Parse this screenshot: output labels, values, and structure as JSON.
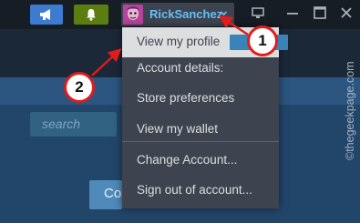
{
  "topbar": {
    "username": "RickSanchez",
    "icons": {
      "announce": "megaphone-icon",
      "notifications": "bell-icon",
      "avatar": "avatar",
      "dropdown": "chevron-down-icon",
      "bigpicture": "monitor-icon",
      "minimize": "minimize-icon",
      "maximize": "maximize-icon",
      "close": "close-icon"
    }
  },
  "menu": {
    "items": [
      {
        "label": "View my profile"
      },
      {
        "label": "Account details:"
      },
      {
        "label": "Store preferences"
      },
      {
        "label": "View my wallet"
      },
      {
        "label": "Change Account..."
      },
      {
        "label": "Sign out of account..."
      }
    ]
  },
  "page": {
    "search_placeholder": "search",
    "button_partial_label": "Co"
  },
  "annotations": {
    "callout_1": "1",
    "callout_2": "2",
    "color": "#e31b1b"
  },
  "watermark": "©thegeekpage.com"
}
